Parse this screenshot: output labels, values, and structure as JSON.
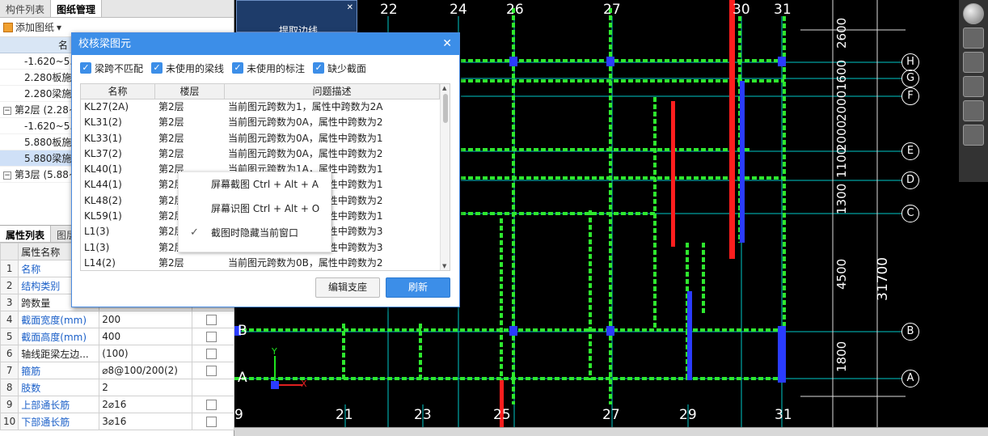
{
  "left_panel": {
    "tabs": [
      "构件列表",
      "图纸管理"
    ],
    "add_label": "添加图纸",
    "tree_header": "名",
    "tree": [
      {
        "label": "-1.620~5.8",
        "type": "item"
      },
      {
        "label": "2.280板施",
        "type": "item"
      },
      {
        "label": "2.280梁施",
        "type": "item"
      },
      {
        "label": "第2层 (2.28~",
        "type": "group"
      },
      {
        "label": "-1.620~5.8",
        "type": "item"
      },
      {
        "label": "5.880板施",
        "type": "item"
      },
      {
        "label": "5.880梁施",
        "type": "item",
        "selected": true
      },
      {
        "label": "第3层 (5.88~",
        "type": "group"
      }
    ],
    "prop_tabs": [
      "属性列表",
      "图层"
    ],
    "prop_header": [
      "",
      "属性名称",
      "",
      ""
    ],
    "props": [
      {
        "n": "1",
        "name": "名称",
        "value": "",
        "blue": true,
        "check": false
      },
      {
        "n": "2",
        "name": "结构类别",
        "value": "",
        "blue": true,
        "check": false
      },
      {
        "n": "3",
        "name": "跨数量",
        "value": "",
        "blue": false,
        "check": false
      },
      {
        "n": "4",
        "name": "截面宽度(mm)",
        "value": "200",
        "blue": true,
        "check": true
      },
      {
        "n": "5",
        "name": "截面高度(mm)",
        "value": "400",
        "blue": true,
        "check": true
      },
      {
        "n": "6",
        "name": "轴线距梁左边...",
        "value": "(100)",
        "blue": false,
        "check": true
      },
      {
        "n": "7",
        "name": "箍筋",
        "value": "⌀8@100/200(2)",
        "blue": true,
        "check": true
      },
      {
        "n": "8",
        "name": "肢数",
        "value": "2",
        "blue": true,
        "check": false
      },
      {
        "n": "9",
        "name": "上部通长筋",
        "value": "2⌀16",
        "blue": true,
        "check": true
      },
      {
        "n": "10",
        "name": "下部通长筋",
        "value": "3⌀16",
        "blue": true,
        "check": true
      }
    ]
  },
  "extract_popup": {
    "title": "提取边线"
  },
  "dialog": {
    "title": "校核梁图元",
    "close": "✕",
    "filters": [
      "梁跨不匹配",
      "未使用的梁线",
      "未使用的标注",
      "缺少截面"
    ],
    "columns": [
      "名称",
      "楼层",
      "问题描述"
    ],
    "rows": [
      [
        "KL27(2A)",
        "第2层",
        "当前图元跨数为1，属性中跨数为2A"
      ],
      [
        "KL31(2)",
        "第2层",
        "当前图元跨数为0A，属性中跨数为2"
      ],
      [
        "KL33(1)",
        "第2层",
        "当前图元跨数为0A，属性中跨数为1"
      ],
      [
        "KL37(2)",
        "第2层",
        "当前图元跨数为0A，属性中跨数为2"
      ],
      [
        "KL40(1)",
        "第2层",
        "当前图元跨数为1A，属性中跨数为1"
      ],
      [
        "KL44(1)",
        "第2层",
        "当前图元跨数为0A，属性中跨数为1"
      ],
      [
        "KL48(2)",
        "第2层",
        "当前图元跨数为0A，属性中跨数为2"
      ],
      [
        "KL59(1)",
        "第2层",
        "当前图元跨数为0A，属性中跨数为1"
      ],
      [
        "L1(3)",
        "第2层",
        "当前图元跨数为0A，属性中跨数为3"
      ],
      [
        "L1(3)",
        "第2层",
        "当前图元跨数为0A，属性中跨数为3"
      ],
      [
        "L14(2)",
        "第2层",
        "当前图元跨数为0B，属性中跨数为2"
      ]
    ],
    "btn_edit": "编辑支座",
    "btn_refresh": "刷新"
  },
  "context_menu": {
    "items": [
      {
        "label": "屏幕截图 Ctrl + Alt + A",
        "checked": false
      },
      {
        "label": "屏幕识图 Ctrl + Alt + O",
        "checked": false
      },
      {
        "label": "截图时隐藏当前窗口",
        "checked": true
      }
    ]
  },
  "canvas": {
    "top_axes": [
      "22",
      "24",
      "26",
      "27",
      "30",
      "31"
    ],
    "bottom_axes": [
      "9",
      "21",
      "23",
      "25",
      "27",
      "29",
      "31"
    ],
    "right_axes": [
      "H",
      "G",
      "F",
      "E",
      "D",
      "C",
      "B",
      "A"
    ],
    "left_axes": [
      "B",
      "A"
    ],
    "dims_right": [
      "2600",
      "1600",
      "2000",
      "2000",
      "1100",
      "1300",
      "4500",
      "1800"
    ],
    "dim_total": "31700",
    "ucs_y": "Y",
    "ucs_x": "X"
  }
}
